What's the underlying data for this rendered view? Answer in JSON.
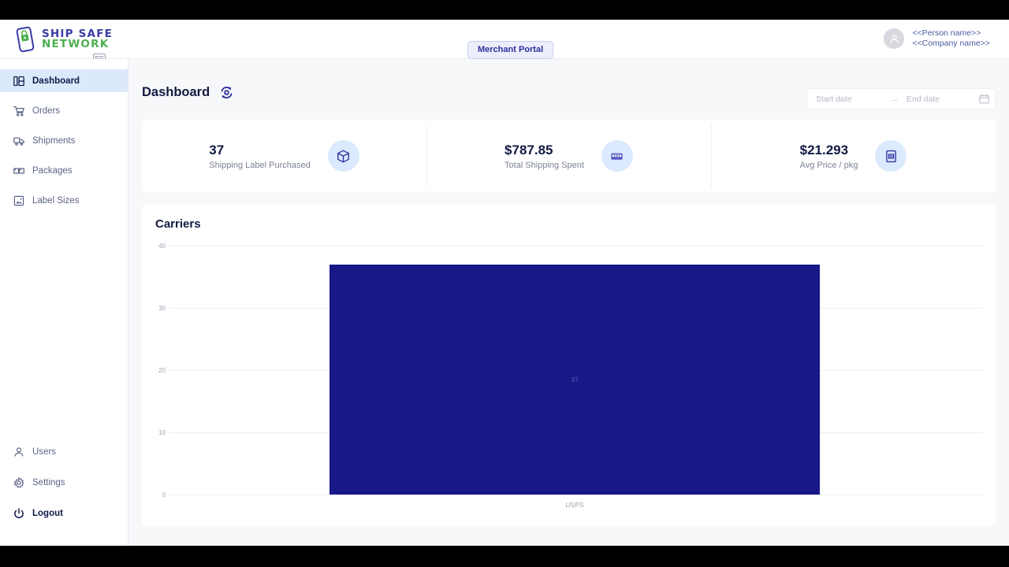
{
  "brand": {
    "logo_line1": "SHIP SAFE",
    "logo_line2": "NETWORK",
    "logo_icon": "phone-lock-icon",
    "menu_toggle_icon": "menu-toggle-icon"
  },
  "header": {
    "portal_badge": "Merchant Portal",
    "user": {
      "person_name": "<<Person name>>",
      "company_name": "<<Company name>>",
      "avatar_icon": "user-avatar-icon"
    }
  },
  "sidebar": {
    "items": [
      {
        "label": "Dashboard",
        "icon": "dashboard-icon",
        "active": true
      },
      {
        "label": "Orders",
        "icon": "cart-icon",
        "active": false
      },
      {
        "label": "Shipments",
        "icon": "truck-icon",
        "active": false
      },
      {
        "label": "Packages",
        "icon": "boxes-icon",
        "active": false
      },
      {
        "label": "Label Sizes",
        "icon": "label-size-icon",
        "active": false
      }
    ],
    "bottom_items": [
      {
        "label": "Users",
        "icon": "user-icon",
        "strong": false
      },
      {
        "label": "Settings",
        "icon": "gear-icon",
        "strong": false
      },
      {
        "label": "Logout",
        "icon": "power-icon",
        "strong": true
      }
    ]
  },
  "page": {
    "title": "Dashboard",
    "refresh_icon": "refresh-sync-icon"
  },
  "daterange": {
    "start_placeholder": "Start date",
    "end_placeholder": "End date",
    "start_value": "",
    "end_value": "",
    "separator": "→",
    "calendar_icon": "calendar-icon"
  },
  "stats": [
    {
      "value": "37",
      "label": "Shipping Label Purchased",
      "icon": "package-box-icon"
    },
    {
      "value": "$787.85",
      "label": "Total Shipping Spent",
      "icon": "cash-money-icon"
    },
    {
      "value": "$21.293",
      "label": "Avg Price / pkg",
      "icon": "label-tag-icon"
    }
  ],
  "colors": {
    "accent": "#2f2f9e",
    "bar": "#181888",
    "sidebar_active_bg": "#dce9fb",
    "bubble_bg": "#dbeafe",
    "brand_green": "#4caf50"
  },
  "chart_data": {
    "type": "bar",
    "title": "Carriers",
    "categories": [
      "USPS"
    ],
    "values": [
      37
    ],
    "data_labels": [
      "37"
    ],
    "xlabel": "",
    "ylabel": "",
    "ylim": [
      0,
      40
    ],
    "yticks": [
      "40",
      "30",
      "20",
      "10",
      "0"
    ],
    "ytick_values": [
      40,
      30,
      20,
      10,
      0
    ],
    "grid": true,
    "legend": "none",
    "bar_color": "#181888"
  }
}
